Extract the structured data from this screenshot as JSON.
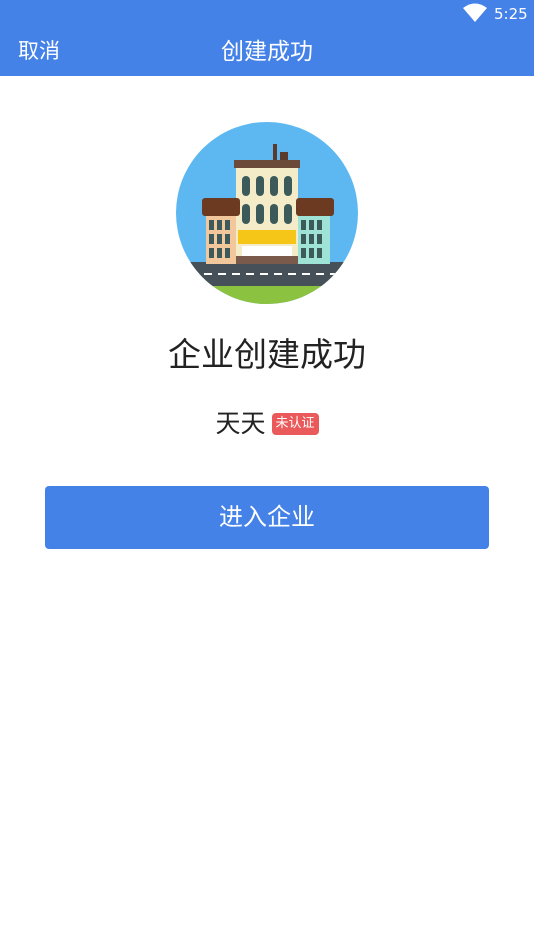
{
  "status_bar": {
    "time": "5:25",
    "wifi_icon": "wifi-icon"
  },
  "header": {
    "cancel_label": "取消",
    "title": "创建成功"
  },
  "logo_icon": "building-icon",
  "main": {
    "success_text": "企业创建成功",
    "company_name": "天天",
    "badge": "未认证",
    "enter_button": "进入企业"
  },
  "colors": {
    "primary": "#4582e8",
    "badge": "#ea5a5a",
    "text": "#222222"
  }
}
